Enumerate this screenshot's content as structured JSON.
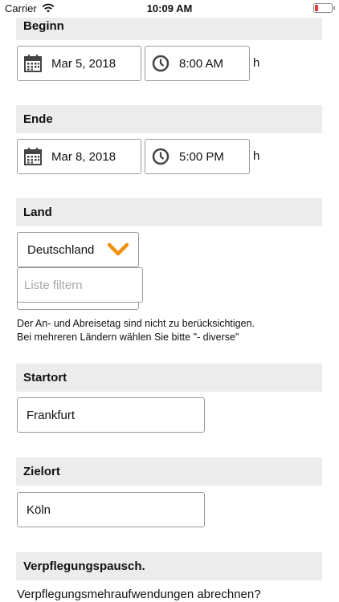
{
  "status_bar": {
    "carrier": "Carrier",
    "time": "10:09 AM",
    "battery_color": "#e53935"
  },
  "accent_color": "#f0900d",
  "sections": {
    "beginn": {
      "title": "Beginn",
      "date": "Mar 5, 2018",
      "time": "8:00 AM",
      "unit": "h"
    },
    "ende": {
      "title": "Ende",
      "date": "Mar 8, 2018",
      "time": "5:00 PM",
      "unit": "h"
    },
    "land": {
      "title": "Land",
      "selected": "Deutschland",
      "filter_placeholder": "Liste filtern",
      "hint_line1": "Der An- und Abreisetag sind nicht zu berücksichtigen.",
      "hint_line2": "Bei mehreren Ländern wählen Sie bitte \"- diverse\""
    },
    "startort": {
      "title": "Startort",
      "value": "Frankfurt"
    },
    "zielort": {
      "title": "Zielort",
      "value": "Köln"
    },
    "verpflegung": {
      "title": "Verpflegungspausch.",
      "question": "Verpflegungsmehraufwendungen abrechnen?"
    }
  },
  "icons": {
    "date": "calendar-icon",
    "time": "clock-icon",
    "dropdown": "chevron-down-icon"
  }
}
